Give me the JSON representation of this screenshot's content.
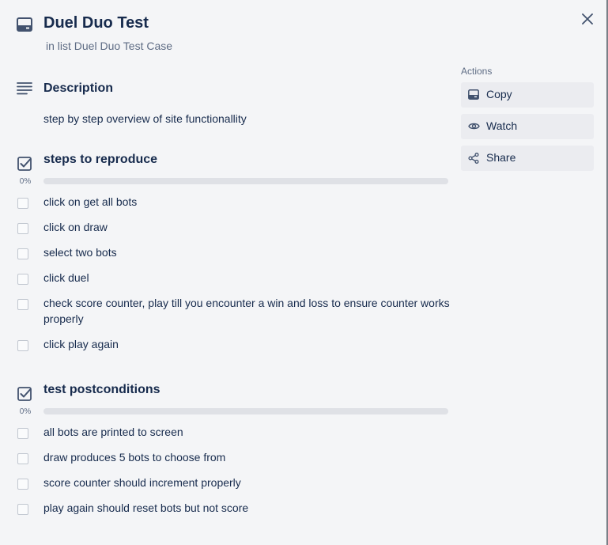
{
  "card": {
    "title": "Duel Duo Test",
    "list_ref": "in list Duel Duo Test Case"
  },
  "description": {
    "heading": "Description",
    "text": "step by step overview of site functionallity"
  },
  "checklists": [
    {
      "title": "steps to reproduce",
      "progress_label": "0%",
      "progress": 0,
      "items": [
        "click on get all bots",
        "click on draw",
        "select two bots",
        "click duel",
        "check score counter, play till you encounter a win and loss to ensure counter works properly",
        "click play again"
      ]
    },
    {
      "title": "test postconditions",
      "progress_label": "0%",
      "progress": 0,
      "items": [
        "all bots are printed to screen",
        "draw produces 5 bots to choose from",
        "score counter should increment properly",
        "play again should reset bots but not score"
      ]
    }
  ],
  "actions": {
    "heading": "Actions",
    "buttons": [
      {
        "label": "Copy",
        "icon": "card-icon"
      },
      {
        "label": "Watch",
        "icon": "eye-icon"
      },
      {
        "label": "Share",
        "icon": "share-icon"
      }
    ]
  }
}
